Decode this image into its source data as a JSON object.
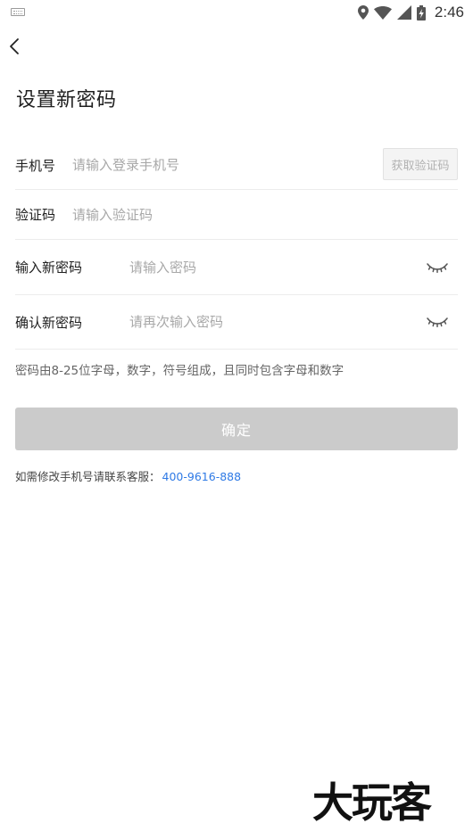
{
  "status_bar": {
    "time": "2:46",
    "icons": [
      "keyboard-icon",
      "location-pin-icon",
      "wifi-icon",
      "cell-signal-icon",
      "battery-charging-icon"
    ]
  },
  "header": {
    "back_icon": "chevron-left-icon",
    "title": "设置新密码"
  },
  "form": {
    "phone": {
      "label": "手机号",
      "placeholder": "请输入登录手机号",
      "value": ""
    },
    "get_code_button": "获取验证码",
    "code": {
      "label": "验证码",
      "placeholder": "请输入验证码",
      "value": ""
    },
    "new_password": {
      "label": "输入新密码",
      "placeholder": "请输入密码",
      "value": "",
      "toggle_icon": "eye-closed-icon"
    },
    "confirm_password": {
      "label": "确认新密码",
      "placeholder": "请再次输入密码",
      "value": "",
      "toggle_icon": "eye-closed-icon"
    }
  },
  "hint": "密码由8-25位字母，数字，符号组成，且同时包含字母和数字",
  "confirm_button": "确定",
  "contact": {
    "text": "如需修改手机号请联系客服：",
    "phone": "400-9616-888"
  },
  "watermark": "大玩客",
  "colors": {
    "button_disabled": "#cbcbcb",
    "link": "#2f7ae5",
    "placeholder": "#a8a8a8"
  }
}
